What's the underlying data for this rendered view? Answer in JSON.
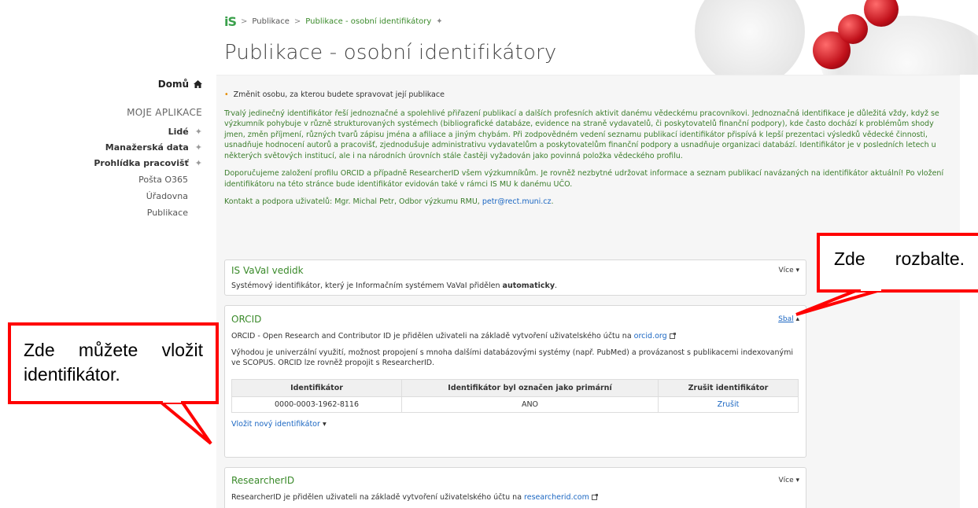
{
  "header": {
    "logo_main": "i",
    "logo_accent": "S",
    "breadcrumb_sep": ">",
    "breadcrumb": [
      {
        "label": "Publikace"
      },
      {
        "label": "Publikace - osobní identifikátory"
      }
    ],
    "pin": "✦",
    "title": "Publikace - osobní identifikátory"
  },
  "sidebar": {
    "home": "Domů",
    "section": "MOJE APLIKACE",
    "items": [
      {
        "label": "Lidé"
      },
      {
        "label": "Manažerská data"
      },
      {
        "label": "Prohlídka pracovišť"
      }
    ],
    "plain_items": [
      "Pošta O365",
      "Úřadovna",
      "Publikace"
    ]
  },
  "main": {
    "bullet": "•",
    "change_person": "Změnit osobu, za kterou budete spravovat její publikace",
    "intro_text": "Trvalý jedinečný identifikátor řeší jednoznačné a spolehlivé přiřazení publikací a dalších profesních aktivit danému vědeckému pracovníkovi. Jednoznačná identifikace je důležitá vždy, když se výzkumník pohybuje v různě strukturovaných systémech (bibliografické databáze, evidence na straně vydavatelů, či poskytovatelů finanční podpory), kde často dochází k problémům shody jmen, změn příjmení, různých tvarů zápisu jména a afiliace a jiným chybám. Při zodpovědném vedení seznamu publikací identifikátor přispívá k lepší prezentaci výsledků vědecké činnosti, usnadňuje hodnocení autorů a pracovišť, zjednodušuje administrativu vydavatelům a poskytovatelům finanční podpory a usnadňuje organizaci databází. Identifikátor je v posledních letech u některých světových institucí, ale i na národních úrovních stále častěji vyžadován jako povinná položka vědeckého profilu.",
    "recommend_text": "Doporučujeme založení profilu ORCID a případně ResearcherID všem výzkumníkům. Je rovněž nezbytné udržovat informace a seznam publikací navázaných na identifikátor aktuální! Po vložení identifikátoru na této stránce bude identifikátor evidován také v rámci IS MU k danému UČO.",
    "contact_prefix": "Kontakt a podpora uživatelů: Mgr. Michal Petr, Odbor výzkumu RMU, ",
    "contact_email": "petr@rect.muni.cz",
    "contact_suffix": "."
  },
  "cards": {
    "vaval": {
      "title": "IS VaVaI vedidk",
      "more": "Více ▾",
      "text_prefix": "Systémový identifikátor, který je Informačním systémem VaVaI přidělen ",
      "text_bold": "automaticky",
      "text_suffix": "."
    },
    "orcid": {
      "title": "ORCID",
      "collapse": "Sbal",
      "collapse_arrow": "▴",
      "text1_prefix": "ORCID - Open Research and Contributor ID je přidělen uživateli na základě vytvoření uživatelského účtu na ",
      "text1_link": "orcid.org",
      "text2": "Výhodou je univerzální využití, možnost propojení s mnoha dalšími databázovými systémy (např. PubMed) a provázanost s publikacemi indexovanými ve SCOPUS. ORCID lze rovněž propojit s ResearcherID.",
      "table": {
        "headers": [
          "Identifikátor",
          "Identifikátor byl označen jako primární",
          "Zrušit identifikátor"
        ],
        "rows": [
          {
            "id": "0000-0003-1962-8116",
            "primary": "ANO",
            "action": "Zrušit"
          }
        ]
      },
      "insert_label": "Vložit nový identifikátor",
      "insert_arrow": "▾"
    },
    "researcherid": {
      "title": "ResearcherID",
      "more": "Více ▾",
      "text_prefix": "ResearcherID je přidělen uživateli na základě vytvoření uživatelského účtu na ",
      "text_link": "researcherid.com"
    }
  },
  "callouts": {
    "right_word1": "Zde",
    "right_word2": "rozbalte.",
    "left_w1": "Zde",
    "left_w2": "můžete",
    "left_w3": "vložit",
    "left_line2": "identifikátor."
  },
  "colors": {
    "callout_border": "#ff0000",
    "link": "#1a66c2",
    "green_text": "#3b7d2c"
  }
}
